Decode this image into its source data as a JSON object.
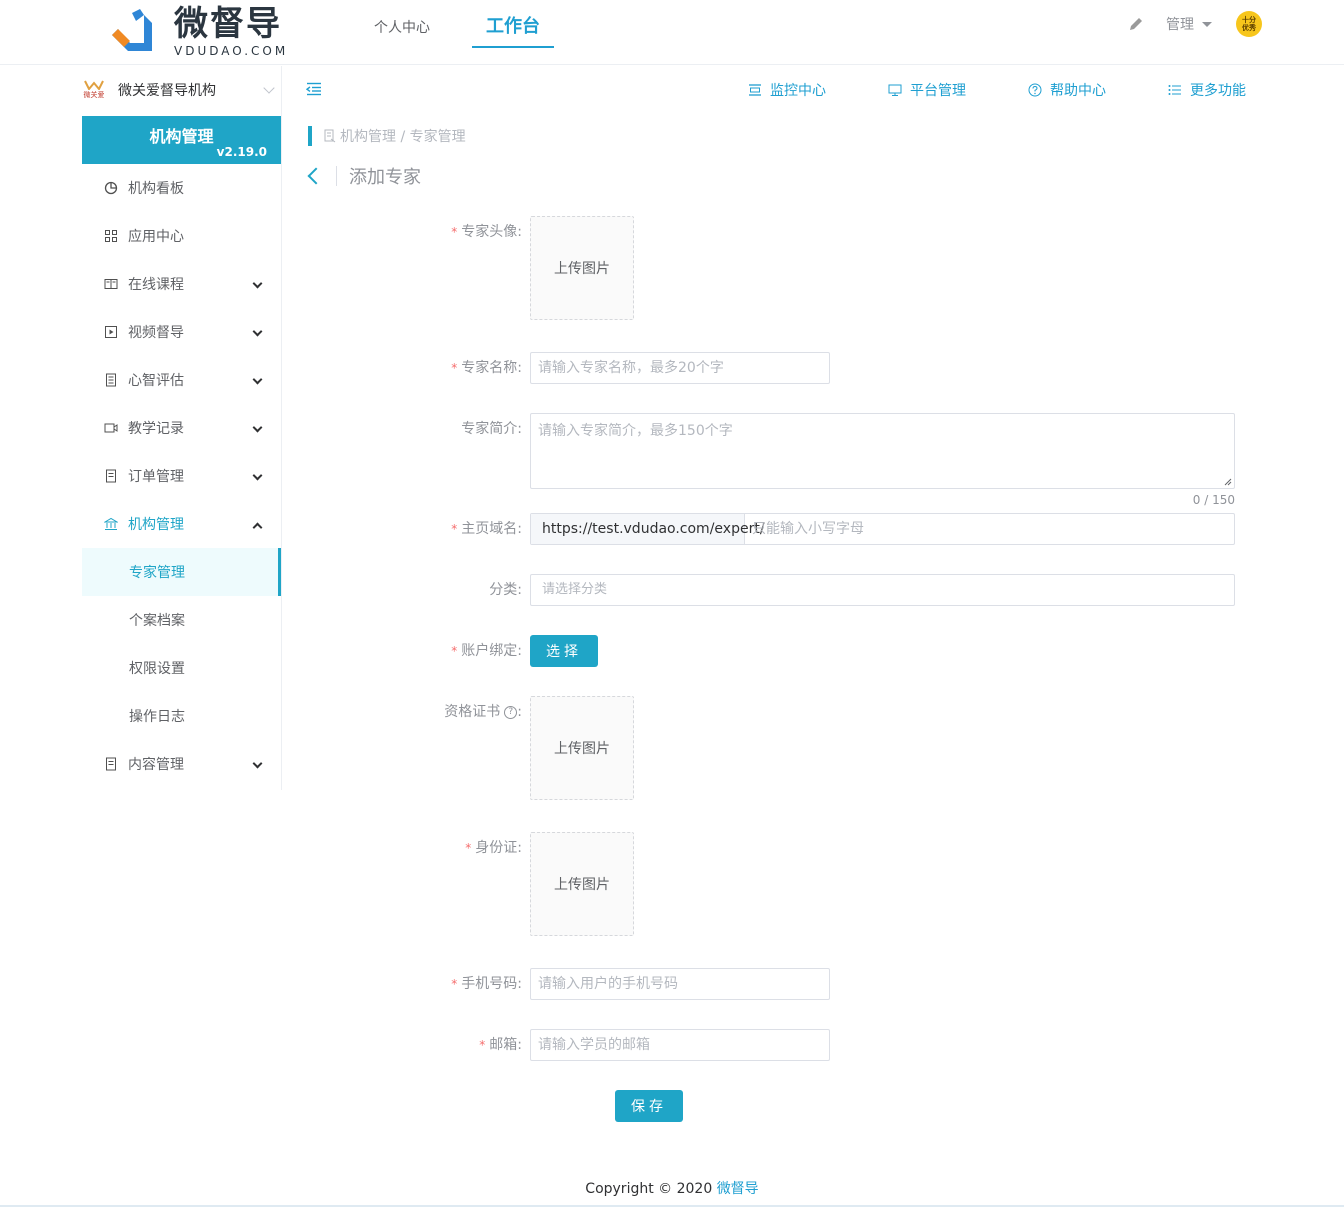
{
  "header": {
    "logo_cn": "微督导",
    "logo_en": "VDUDAO.COM",
    "nav": [
      {
        "label": "个人中心"
      },
      {
        "label": "工作台"
      }
    ],
    "admin_label": "管理",
    "avatar_line1": "十分",
    "avatar_line2": "优秀"
  },
  "sidebar": {
    "org_logo_text": "微关爱",
    "org_name": "微关爱督导机构",
    "banner_title": "机构管理",
    "banner_version": "v2.19.0",
    "items": [
      {
        "label": "机构看板"
      },
      {
        "label": "应用中心"
      },
      {
        "label": "在线课程"
      },
      {
        "label": "视频督导"
      },
      {
        "label": "心智评估"
      },
      {
        "label": "教学记录"
      },
      {
        "label": "订单管理"
      },
      {
        "label": "机构管理"
      },
      {
        "label": "内容管理"
      }
    ],
    "submenu": [
      {
        "label": "专家管理"
      },
      {
        "label": "个案档案"
      },
      {
        "label": "权限设置"
      },
      {
        "label": "操作日志"
      }
    ]
  },
  "toolbar": {
    "links": [
      {
        "label": "监控中心"
      },
      {
        "label": "平台管理"
      },
      {
        "label": "帮助中心"
      },
      {
        "label": "更多功能"
      }
    ]
  },
  "breadcrumb": {
    "text": "机构管理 / 专家管理"
  },
  "page": {
    "title": "添加专家"
  },
  "form": {
    "avatar_label": "专家头像:",
    "upload_text": "上传图片",
    "name_label": "专家名称:",
    "name_placeholder": "请输入专家名称，最多20个字",
    "intro_label": "专家简介:",
    "intro_placeholder": "请输入专家简介，最多150个字",
    "intro_counter": "0 / 150",
    "domain_label": "主页域名:",
    "domain_prefix": "https://test.vdudao.com/expert/",
    "domain_placeholder": "只能输入小写字母",
    "category_label": "分类:",
    "category_placeholder": "请选择分类",
    "account_label": "账户绑定:",
    "select_button": "选择",
    "cert_label": "资格证书",
    "cert_colon": ":",
    "idcard_label": "身份证:",
    "phone_label": "手机号码:",
    "phone_placeholder": "请输入用户的手机号码",
    "email_label": "邮箱:",
    "email_placeholder": "请输入学员的邮箱",
    "save_button": "保存"
  },
  "footer": {
    "copyright": "Copyright © 2020 ",
    "brand": "微督导"
  },
  "colors": {
    "primary": "#1fa5c7",
    "link": "#1f9fd1",
    "required": "#f56c6c"
  }
}
